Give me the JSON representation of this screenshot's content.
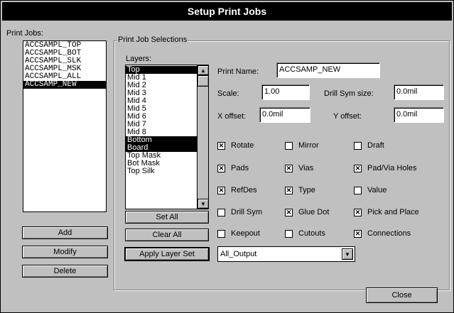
{
  "title": "Setup Print Jobs",
  "print_jobs": {
    "label": "Print Jobs:",
    "items": [
      "ACCSAMPL_TOP",
      "ACCSAMPL_BOT",
      "ACCSAMPL_SLK",
      "ACCSAMPL_MSK",
      "ACCSAMPL_ALL",
      "ACCSAMP_NEW"
    ],
    "selected": "ACCSAMP_NEW"
  },
  "job_buttons": {
    "add": "Add",
    "modify": "Modify",
    "delete": "Delete"
  },
  "selections": {
    "title": "Print Job Selections",
    "layers_label": "Layers:",
    "layers": [
      "Top",
      "Mid 1",
      "Mid 2",
      "Mid 3",
      "Mid 4",
      "Mid 5",
      "Mid 6",
      "Mid 7",
      "Mid 8",
      "Bottom",
      "Board",
      "Top Mask",
      "Bot Mask",
      "Top Silk"
    ],
    "selected_layers": [
      "Top",
      "Bottom",
      "Board"
    ],
    "set_all": "Set All",
    "clear_all": "Clear All",
    "apply_layer_set": "Apply Layer Set",
    "layer_set_value": "All_Output"
  },
  "fields": {
    "print_name_label": "Print Name:",
    "print_name_value": "ACCSAMP_NEW",
    "scale_label": "Scale:",
    "scale_value": "1.00",
    "drill_sym_size_label": "Drill Sym size:",
    "drill_sym_size_value": "0.0mil",
    "x_offset_label": "X offset:",
    "x_offset_value": "0.0mil",
    "y_offset_label": "Y offset:",
    "y_offset_value": "0.0mil"
  },
  "options": [
    {
      "label": "Rotate",
      "checked": true
    },
    {
      "label": "Mirror",
      "checked": false
    },
    {
      "label": "Draft",
      "checked": false
    },
    {
      "label": "Pads",
      "checked": true
    },
    {
      "label": "Vias",
      "checked": true
    },
    {
      "label": "Pad/Via Holes",
      "checked": true
    },
    {
      "label": "RefDes",
      "checked": true
    },
    {
      "label": "Type",
      "checked": true
    },
    {
      "label": "Value",
      "checked": false
    },
    {
      "label": "Drill Sym",
      "checked": false
    },
    {
      "label": "Glue Dot",
      "checked": true
    },
    {
      "label": "Pick and Place",
      "checked": true
    },
    {
      "label": "Keepout",
      "checked": false
    },
    {
      "label": "Cutouts",
      "checked": false
    },
    {
      "label": "Connections",
      "checked": true
    }
  ],
  "close_label": "Close",
  "check_mark": "✕",
  "icons": {
    "scroll_up": "▲",
    "scroll_down": "▼",
    "combo": "▼"
  }
}
